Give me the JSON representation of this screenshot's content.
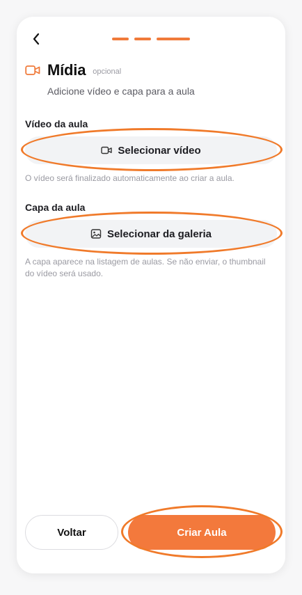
{
  "theme": {
    "accent": "#f07a3a",
    "highlight_ring": "#f07a2a"
  },
  "nav": {
    "back_icon": "chevron-left-icon",
    "progress_steps": 3,
    "current_step": 3
  },
  "header": {
    "icon": "video-camera-icon",
    "title": "Mídia",
    "optional_tag": "opcional",
    "subtitle": "Adicione vídeo e capa para a aula"
  },
  "video_section": {
    "label": "Vídeo da aula",
    "button_icon": "video-camera-icon",
    "button_label": "Selecionar vídeo",
    "hint": "O vídeo será finalizado automaticamente ao criar a aula."
  },
  "cover_section": {
    "label": "Capa da aula",
    "button_icon": "image-icon",
    "button_label": "Selecionar da galeria",
    "hint": "A capa aparece na listagem de aulas. Se não enviar, o thumbnail do vídeo será usado."
  },
  "footer": {
    "back_label": "Voltar",
    "create_label": "Criar Aula"
  }
}
